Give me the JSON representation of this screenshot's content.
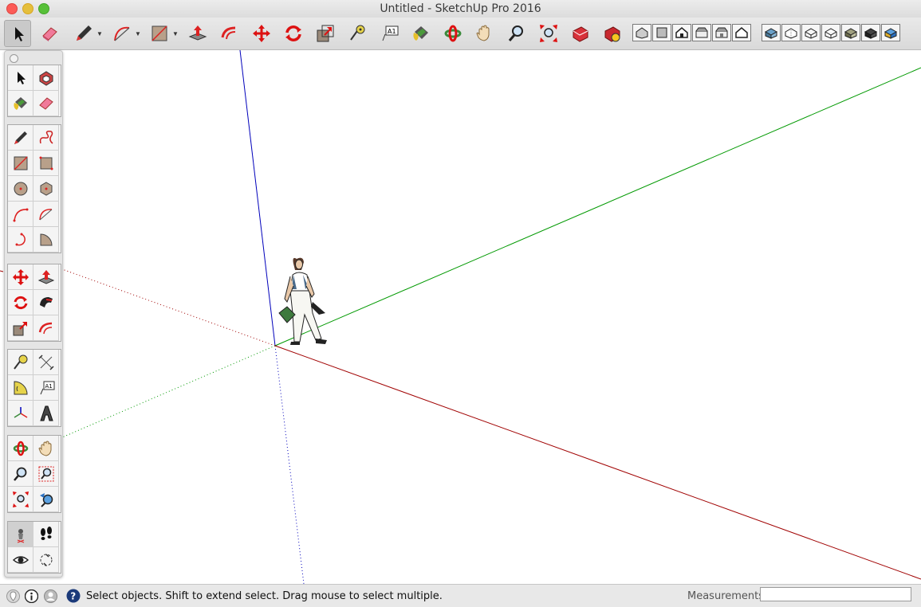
{
  "window": {
    "title": "Untitled - SketchUp Pro 2016"
  },
  "toolbar": {
    "tools": [
      {
        "name": "select-icon",
        "active": true
      },
      {
        "name": "eraser-icon"
      },
      {
        "name": "pencil-icon"
      },
      {
        "name": "arc-icon"
      },
      {
        "name": "rectangle-icon"
      },
      {
        "name": "push-pull-icon"
      },
      {
        "name": "offset-icon"
      },
      {
        "name": "move-icon"
      },
      {
        "name": "rotate-icon"
      },
      {
        "name": "scale-icon"
      },
      {
        "name": "tape-measure-icon"
      },
      {
        "name": "text-icon"
      },
      {
        "name": "paint-bucket-icon"
      },
      {
        "name": "orbit-icon"
      },
      {
        "name": "pan-icon"
      },
      {
        "name": "zoom-icon"
      },
      {
        "name": "zoom-extents-icon"
      },
      {
        "name": "warehouse-icon"
      },
      {
        "name": "extension-warehouse-icon"
      }
    ],
    "views": [
      "iso-view-icon",
      "top-view-icon",
      "front-view-icon",
      "right-view-icon",
      "back-view-icon",
      "left-view-icon"
    ],
    "styles": [
      "xray-style-icon",
      "back-edges-style-icon",
      "wireframe-style-icon",
      "hidden-line-style-icon",
      "shaded-style-icon",
      "shaded-textures-style-icon",
      "monochrome-style-icon"
    ]
  },
  "palette": {
    "groups": [
      [
        "select-icon",
        "make-component-icon",
        "paint-bucket-icon",
        "eraser-icon"
      ],
      [
        "line-icon",
        "freehand-icon",
        "rectangle-icon",
        "rotated-rectangle-icon",
        "circle-icon",
        "polygon-icon",
        "arc-icon",
        "two-point-arc-icon",
        "three-point-arc-icon",
        "pie-icon"
      ],
      [
        "move-icon",
        "push-pull-icon",
        "rotate-icon",
        "follow-me-icon",
        "scale-icon",
        "offset-icon"
      ],
      [
        "tape-measure-icon",
        "dimension-icon",
        "protractor-icon",
        "text-icon",
        "axes-icon",
        "3d-text-icon"
      ],
      [
        "orbit-icon",
        "pan-icon",
        "zoom-icon",
        "zoom-window-icon",
        "zoom-extents-icon",
        "previous-view-icon"
      ],
      [
        "position-camera-icon",
        "walk-icon",
        "look-around-icon",
        "section-plane-icon"
      ]
    ]
  },
  "status": {
    "message": "Select objects. Shift to extend select. Drag mouse to select multiple.",
    "measurements_label": "Measurements",
    "measurements_value": ""
  },
  "colors": {
    "red_axis": "#a00000",
    "green_axis": "#009900",
    "blue_axis": "#0000bb"
  }
}
